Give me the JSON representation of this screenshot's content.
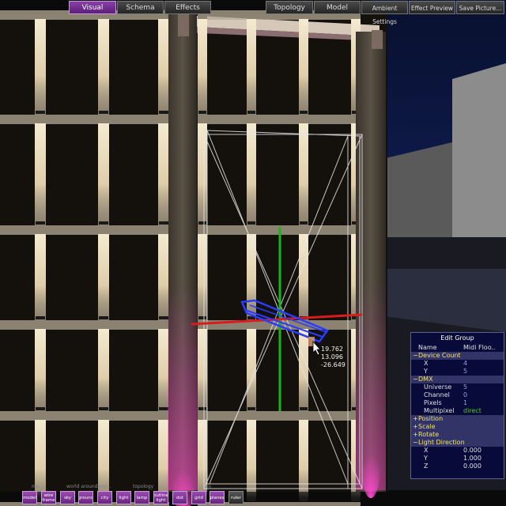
{
  "tabs_left": [
    {
      "label": "Visual",
      "active": true
    },
    {
      "label": "Schema",
      "active": false
    },
    {
      "label": "Effects",
      "active": false
    }
  ],
  "tabs_right": [
    {
      "label": "Topology"
    },
    {
      "label": "Model"
    },
    {
      "label": "Ambient Settings"
    },
    {
      "label": "Effect Preview"
    },
    {
      "label": "Save Picture..."
    }
  ],
  "readout": {
    "x": "19.762",
    "y": "13.096",
    "z": "-26.649"
  },
  "edit_group": {
    "title": "Edit Group",
    "header": {
      "name": "Name",
      "value": "Midi Floo.."
    },
    "device_count": {
      "label": "Device Count",
      "x_label": "X",
      "x": "4",
      "y_label": "Y",
      "y": "5"
    },
    "dmx": {
      "label": "DMX",
      "universe_label": "Universe",
      "universe": "5",
      "channel_label": "Channel",
      "channel": "0",
      "pixels_label": "Pixels",
      "pixels": "1",
      "multipixel_label": "Multipixel",
      "multipixel": "direct"
    },
    "position": "Position",
    "scale": "Scale",
    "rotate": "Rotate",
    "light_direction": {
      "label": "Light Direction",
      "x_label": "X",
      "x": "0.000",
      "y_label": "Y",
      "y": "1.000",
      "z_label": "Z",
      "z": "0.000"
    },
    "expand_sign": "+",
    "collapse_sign": "−"
  },
  "toolbar": {
    "group_labels": [
      "mo...",
      "world around mo...",
      "topology",
      "...ani"
    ],
    "buttons": [
      {
        "label": "model",
        "on": true
      },
      {
        "label": "wire frame",
        "on": true
      },
      {
        "label": "sky",
        "on": true
      },
      {
        "label": "ground",
        "on": true
      },
      {
        "label": "city",
        "on": true
      },
      {
        "label": "light",
        "on": true
      },
      {
        "label": "lamp",
        "on": true
      },
      {
        "label": "outline light",
        "on": true
      },
      {
        "label": "dot",
        "on": true
      },
      {
        "label": "grid",
        "on": true
      },
      {
        "label": "planes",
        "on": true
      },
      {
        "label": "ruler",
        "on": false
      }
    ]
  },
  "colors": {
    "accent": "#7a2f96",
    "axis_x": "#d81b1b",
    "axis_y": "#19b419",
    "axis_z": "#2a3cff",
    "facade_frame": "#b3a894",
    "lamp_glow": "#ffe8c0",
    "magenta_glow": "#ff40c8",
    "sky": "#0b1640"
  }
}
